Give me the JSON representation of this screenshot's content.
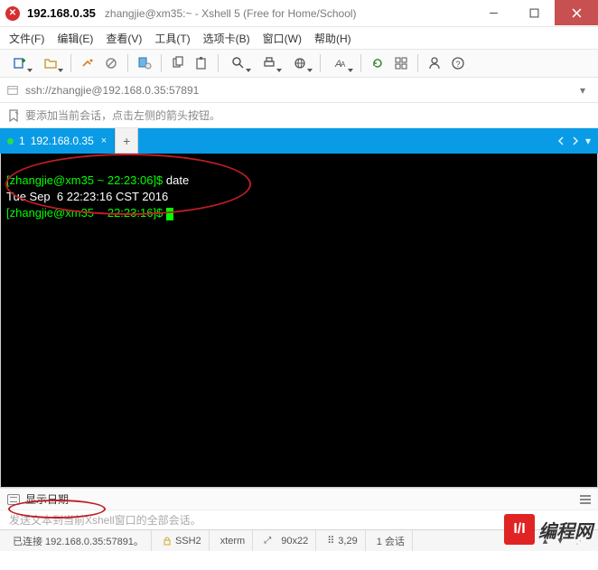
{
  "title": {
    "host": "192.168.0.35",
    "subtitle": "zhangjie@xm35:~ - Xshell 5 (Free for Home/School)"
  },
  "menu": {
    "file": "文件(F)",
    "edit": "编辑(E)",
    "view": "查看(V)",
    "tools": "工具(T)",
    "tabs": "选项卡(B)",
    "window": "窗口(W)",
    "help": "帮助(H)"
  },
  "address": {
    "url": "ssh://zhangjie@192.168.0.35:57891"
  },
  "hint": {
    "text": "要添加当前会话，点击左侧的箭头按钮。"
  },
  "tab": {
    "index": "1",
    "name": "192.168.0.35",
    "close": "×",
    "add": "+"
  },
  "terminal": {
    "line1_prompt": "[zhangjie@xm35 ~ 22:23:06]$ ",
    "line1_cmd": "date",
    "line2": "Tue Sep  6 22:23:16 CST 2016",
    "line3_prompt": "[zhangjie@xm35 ~ 22:23:16]$ "
  },
  "cmd": {
    "text": "显示日期"
  },
  "sendhint": "发送文本到当前Xshell窗口的全部会话。",
  "status": {
    "conn": "已连接 192.168.0.35:57891。",
    "proto": "SSH2",
    "term": "xterm",
    "size": "90x22",
    "cursor": "3,29",
    "sess": "1 会话"
  },
  "watermark": "编程网"
}
